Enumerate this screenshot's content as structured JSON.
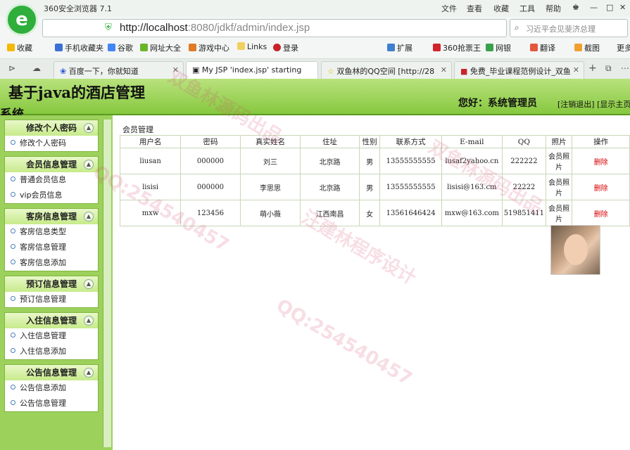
{
  "browser": {
    "title": "360安全浏览器 7.1",
    "menu": [
      "文件",
      "查看",
      "收藏",
      "工具",
      "帮助"
    ],
    "url_host": "http://localhost",
    "url_path": ":8080/jdkf/admin/index.jsp",
    "search_placeholder": "习近平会见斐济总理",
    "bookmarks": [
      "收藏",
      "手机收藏夹",
      "谷歌",
      "网址大全",
      "游戏中心",
      "Links",
      "登录",
      "扩展",
      "360抢票王",
      "网银",
      "翻译",
      "截图",
      "更多"
    ],
    "tabs": [
      "百度一下，你就知道",
      "My JSP 'index.jsp' starting",
      "双鱼林的QQ空间 [http://28",
      "免费_毕业课程范例设计_双鱼"
    ]
  },
  "header": {
    "title_line1": "基于java的酒店管理",
    "title_line2": "系统",
    "greeting": "您好：系统管理员",
    "logout": "[注销退出]",
    "show_main": "[显示主页]"
  },
  "sidebar": {
    "groups": [
      {
        "title": "修改个人密码",
        "items": [
          "修改个人密码"
        ]
      },
      {
        "title": "会员信息管理",
        "items": [
          "普通会员信息",
          "vip会员信息"
        ]
      },
      {
        "title": "客房信息管理",
        "items": [
          "客房信息类型",
          "客房信息管理",
          "客房信息添加"
        ]
      },
      {
        "title": "预订信息管理",
        "items": [
          "预订信息管理"
        ]
      },
      {
        "title": "入住信息管理",
        "items": [
          "入住信息管理",
          "入住信息添加"
        ]
      },
      {
        "title": "公告信息管理",
        "items": [
          "公告信息添加",
          "公告信息管理"
        ]
      }
    ]
  },
  "content": {
    "breadcrumb": "会员管理",
    "columns": [
      "用户名",
      "密码",
      "真实姓名",
      "住址",
      "性别",
      "联系方式",
      "E-mail",
      "QQ",
      "照片",
      "操作"
    ],
    "rows": [
      [
        "liusan",
        "000000",
        "刘三",
        "北京路",
        "男",
        "13555555555",
        "lusaf2yahoo.cn",
        "222222",
        "会员照片",
        "删除"
      ],
      [
        "lisisi",
        "000000",
        "李思思",
        "北京路",
        "男",
        "13555555555",
        "lisisi@163.cm",
        "22222",
        "会员照片",
        "删除"
      ],
      [
        "mxw",
        "123456",
        "萌小薇",
        "江西南昌",
        "女",
        "13561646424",
        "mxw@163.com",
        "519851411",
        "会员照片",
        "删除"
      ]
    ]
  },
  "watermarks": [
    "双鱼林源码出品",
    "QQ:254540457",
    "汪建林程序设计"
  ]
}
